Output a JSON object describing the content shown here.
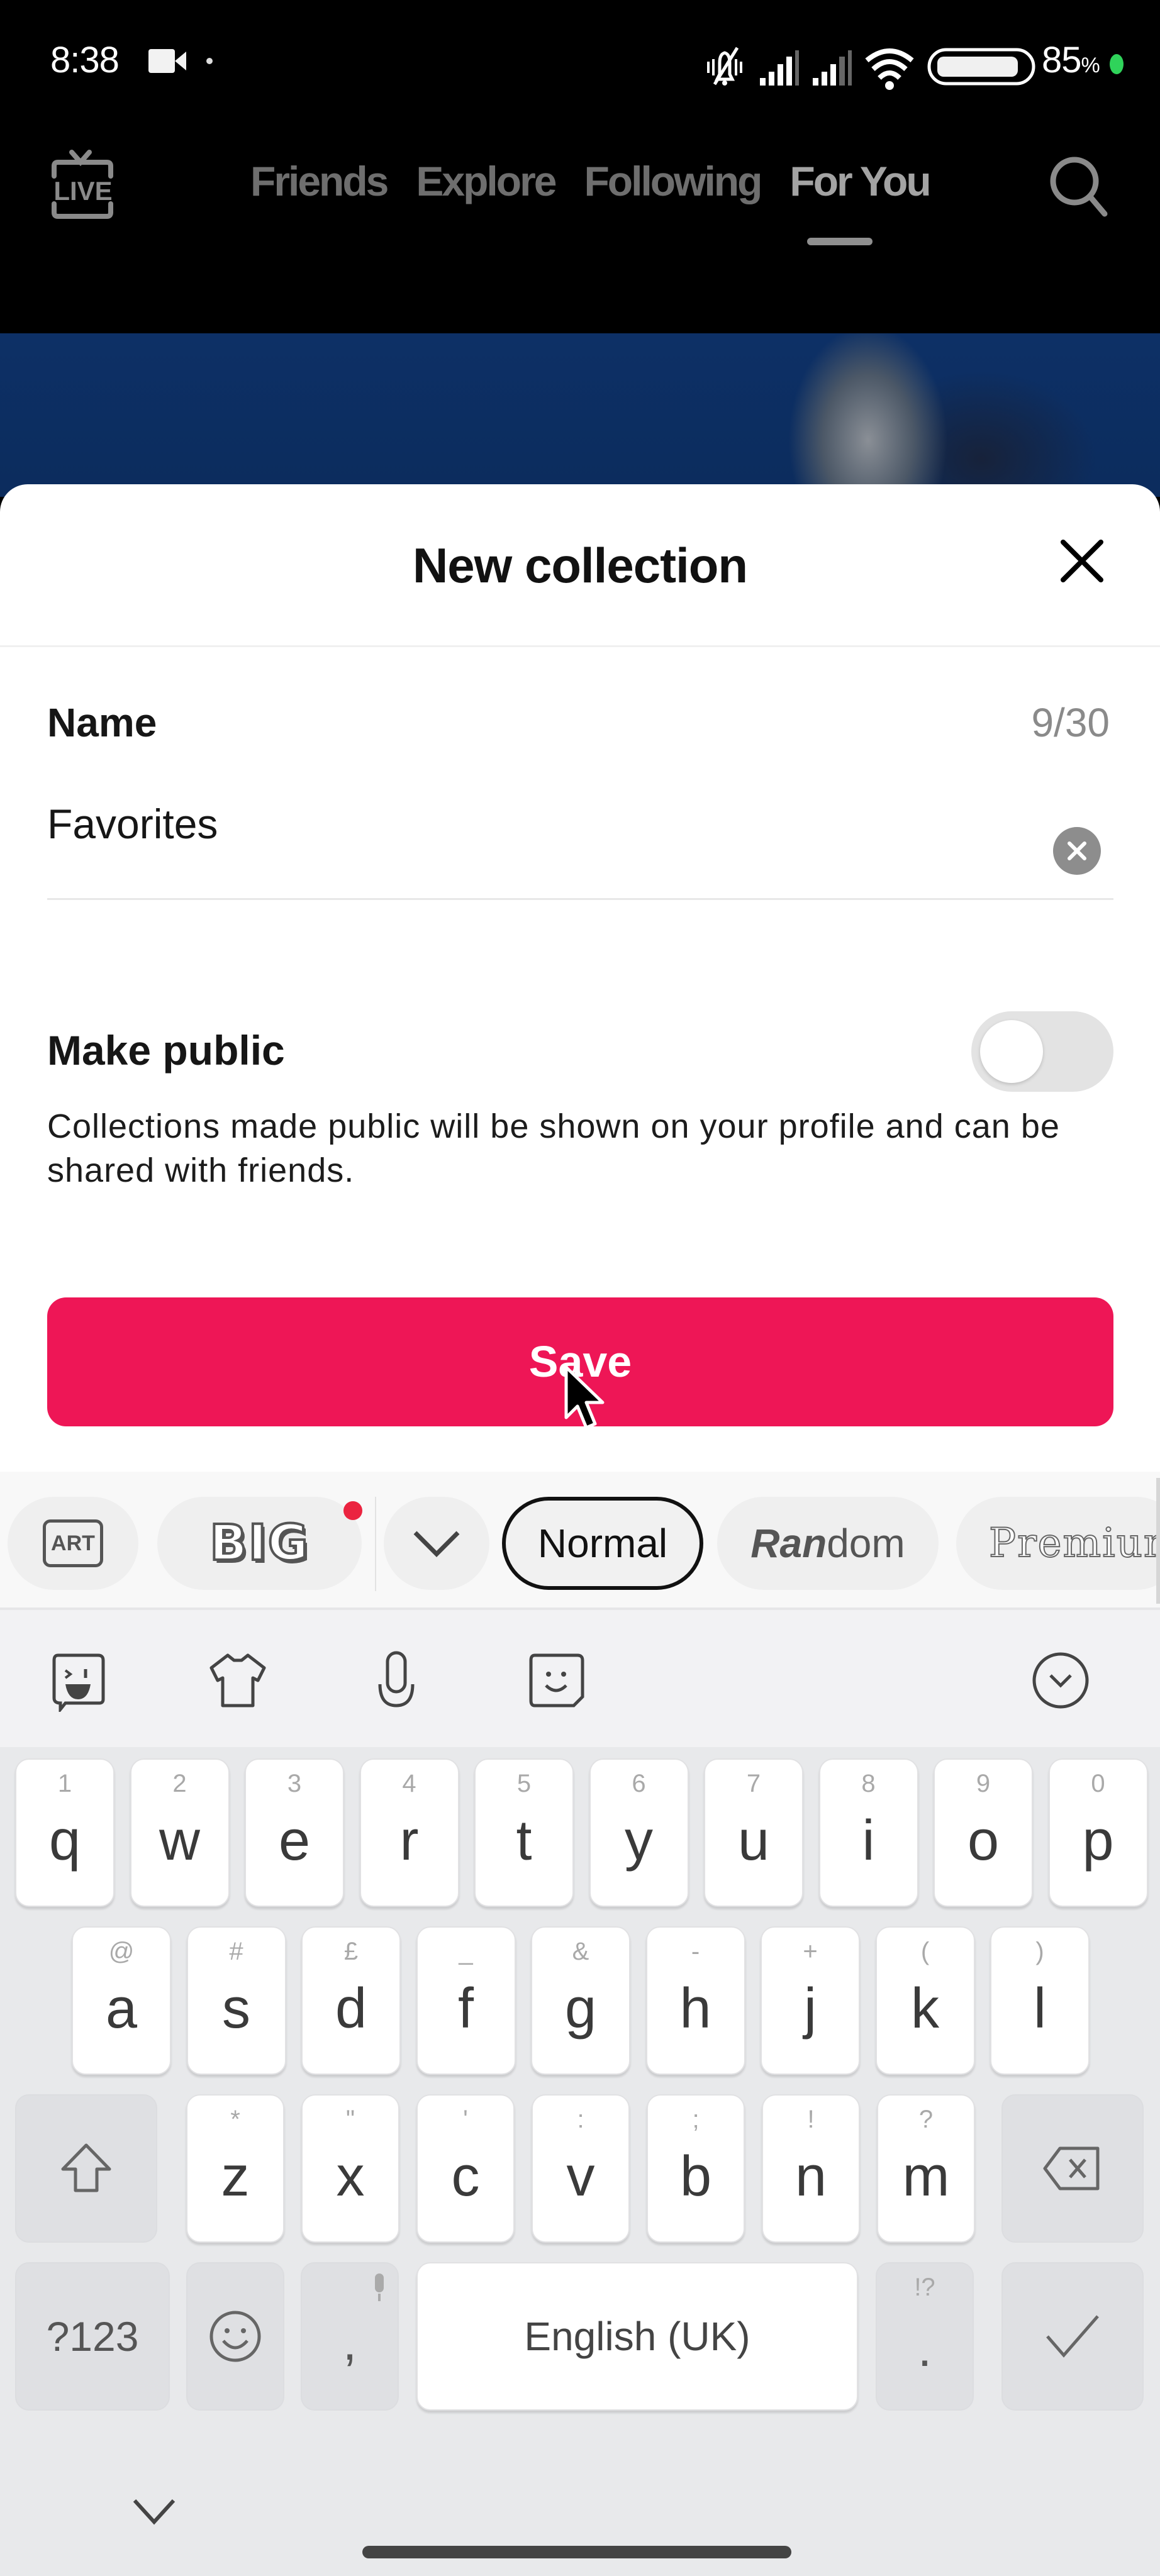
{
  "status_bar": {
    "time": "8:38",
    "battery_percent": "85",
    "battery_symbol": "%",
    "icons": [
      "video-recording-icon",
      "notification-dot",
      "mute-vibrate-icon",
      "signal-icon-sim1",
      "signal-icon-sim2",
      "wifi-icon",
      "battery-icon",
      "charging-dot"
    ]
  },
  "header": {
    "live_label": "LIVE",
    "tabs": [
      {
        "label": "Friends",
        "active": false
      },
      {
        "label": "Explore",
        "active": false
      },
      {
        "label": "Following",
        "active": false
      },
      {
        "label": "For You",
        "active": true
      }
    ],
    "search_icon": "search-icon"
  },
  "sheet": {
    "title": "New collection",
    "close_icon": "close-icon",
    "name_label": "Name",
    "name_counter": "9/30",
    "name_value": "Favorites",
    "make_public_label": "Make public",
    "make_public_on": false,
    "make_public_description": "Collections made public will be shown on your profile and can be shared with friends.",
    "save_label": "Save",
    "accent_color": "#EE1656"
  },
  "keyboard": {
    "font_styles": {
      "art_label": "ART",
      "big_label": "BIG",
      "big_has_badge": true,
      "normal_label": "Normal",
      "random_bold": "Ran",
      "random_rest": "dom",
      "premium_label": "Premium",
      "selected": "Normal"
    },
    "toolbar_icons": [
      "sticker-icon",
      "theme-shirt-icon",
      "microphone-icon",
      "emoji-sticker-icon",
      "collapse-toolbar-icon"
    ],
    "row1": [
      {
        "ch": "q",
        "hint": "1"
      },
      {
        "ch": "w",
        "hint": "2"
      },
      {
        "ch": "e",
        "hint": "3"
      },
      {
        "ch": "r",
        "hint": "4"
      },
      {
        "ch": "t",
        "hint": "5"
      },
      {
        "ch": "y",
        "hint": "6"
      },
      {
        "ch": "u",
        "hint": "7"
      },
      {
        "ch": "i",
        "hint": "8"
      },
      {
        "ch": "o",
        "hint": "9"
      },
      {
        "ch": "p",
        "hint": "0"
      }
    ],
    "row2": [
      {
        "ch": "a",
        "hint": "@"
      },
      {
        "ch": "s",
        "hint": "#"
      },
      {
        "ch": "d",
        "hint": "£"
      },
      {
        "ch": "f",
        "hint": "_"
      },
      {
        "ch": "g",
        "hint": "&"
      },
      {
        "ch": "h",
        "hint": "-"
      },
      {
        "ch": "j",
        "hint": "+"
      },
      {
        "ch": "k",
        "hint": "("
      },
      {
        "ch": "l",
        "hint": ")"
      }
    ],
    "row3": [
      {
        "ch": "z",
        "hint": "*"
      },
      {
        "ch": "x",
        "hint": "\""
      },
      {
        "ch": "c",
        "hint": "'"
      },
      {
        "ch": "v",
        "hint": ":"
      },
      {
        "ch": "b",
        "hint": ";"
      },
      {
        "ch": "n",
        "hint": "!"
      },
      {
        "ch": "m",
        "hint": "?"
      }
    ],
    "symbols_label": "?123",
    "comma_label": ",",
    "space_label": "English (UK)",
    "period_label": ".",
    "period_hint": "!?"
  }
}
